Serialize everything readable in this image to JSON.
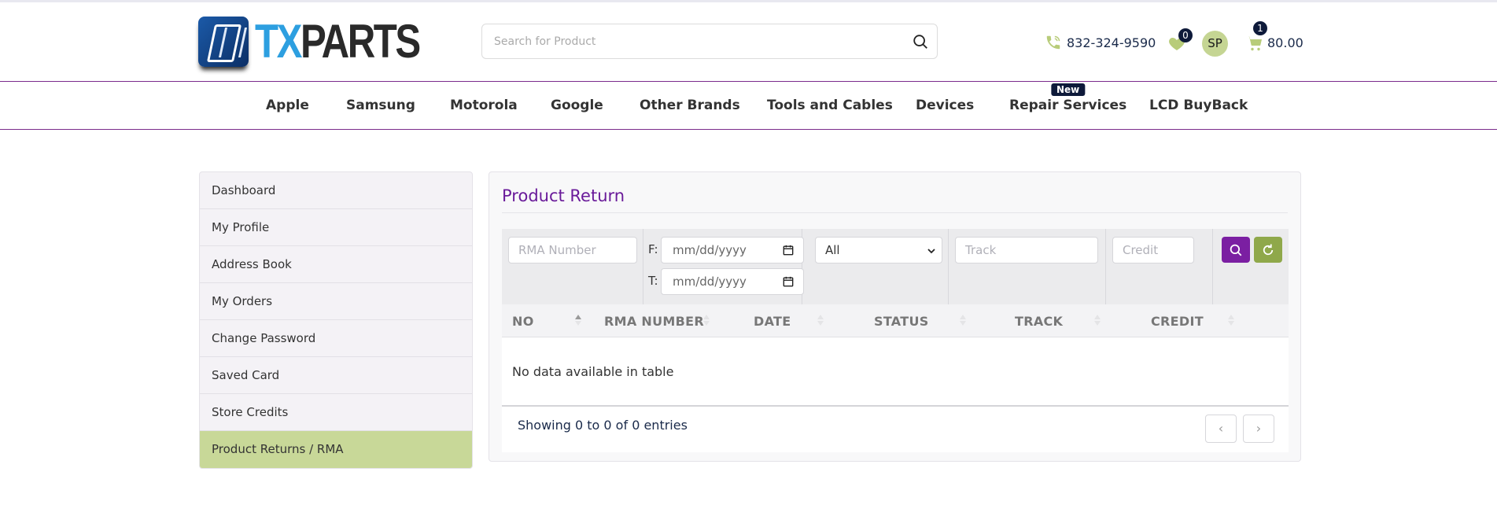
{
  "brand": {
    "tx": "TX",
    "parts": "PARTS"
  },
  "search": {
    "placeholder": "Search for Product"
  },
  "header": {
    "phone": "832-324-9590",
    "wishlist_count": "0",
    "avatar_initials": "SP",
    "cart_count": "1",
    "cart_total": "80.00"
  },
  "nav": {
    "items": [
      "Apple",
      "Samsung",
      "Motorola",
      "Google",
      "Other Brands",
      "Tools and Cables",
      "Devices",
      "Repair Services",
      "LCD BuyBack"
    ],
    "new_badge": "New"
  },
  "sidebar": {
    "items": [
      "Dashboard",
      "My Profile",
      "Address Book",
      "My Orders",
      "Change Password",
      "Saved Card",
      "Store Credits",
      "Product Returns / RMA"
    ],
    "active_index": 7
  },
  "panel": {
    "title": "Product Return",
    "filters": {
      "rma_placeholder": "RMA Number",
      "from_label": "F:",
      "to_label": "T:",
      "date_placeholder": "mm/dd/yyyy",
      "status_selected": "All",
      "track_placeholder": "Track",
      "credit_placeholder": "Credit"
    },
    "table": {
      "columns": [
        "NO",
        "RMA NUMBER",
        "DATE",
        "STATUS",
        "TRACK",
        "CREDIT"
      ],
      "empty_message": "No data available in table",
      "info": "Showing 0 to 0 of 0 entries",
      "prev": "‹",
      "next": "›"
    }
  },
  "colors": {
    "accent_purple": "#7b1fa2",
    "accent_green": "#c8d898",
    "reset_green": "#8fa84a",
    "tx_blue": "#2d9fe0"
  }
}
